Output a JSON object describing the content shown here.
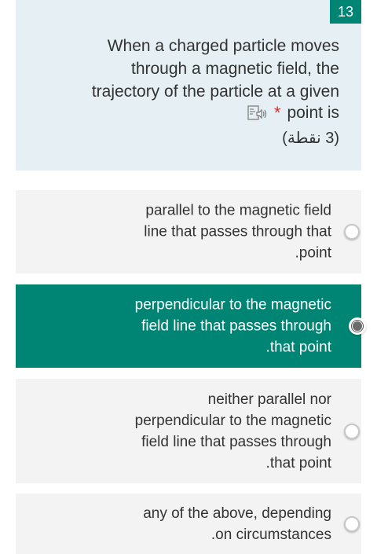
{
  "question": {
    "number": "13",
    "lines": [
      "When a charged particle moves",
      "through a magnetic field, the",
      "trajectory of the particle at a given"
    ],
    "line4": "point is",
    "required_marker": "*",
    "points": "(3 نقطة)",
    "icon": "speaker-icon"
  },
  "options": [
    {
      "lines": [
        "parallel to the magnetic field",
        "line that passes through that",
        ".point"
      ],
      "selected": false
    },
    {
      "lines": [
        "perpendicular to the magnetic",
        "field line that passes through",
        ".that point"
      ],
      "selected": true
    },
    {
      "lines": [
        "neither parallel nor",
        "perpendicular to the magnetic",
        "field line that passes through",
        ".that point"
      ],
      "selected": false
    },
    {
      "lines": [
        "any of the above, depending",
        ".on circumstances"
      ],
      "selected": false
    }
  ],
  "colors": {
    "accent": "#008575",
    "question_bg": "#e6eff4",
    "option_bg": "#f3f3f3",
    "required": "#d32f2f"
  }
}
